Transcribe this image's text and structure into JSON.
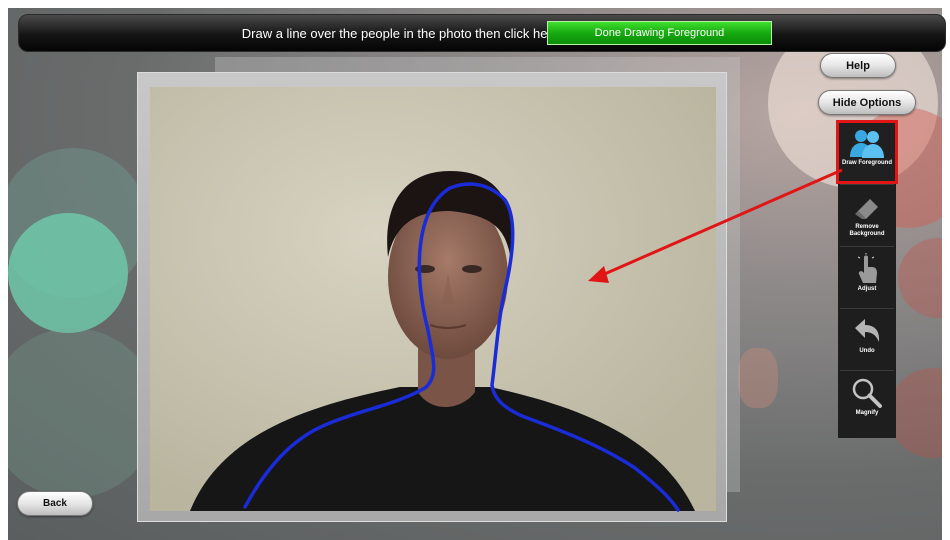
{
  "topbar": {
    "instruction": "Draw a line over the people in the photo then click here",
    "done_button": "Done Drawing Foreground"
  },
  "side_buttons": {
    "help": "Help",
    "hide_options": "Hide Options"
  },
  "tools": [
    {
      "label": "Draw Foreground",
      "icon": "people-icon",
      "selected": true
    },
    {
      "label": "Remove Background",
      "icon": "eraser-icon",
      "selected": false
    },
    {
      "label": "Adjust",
      "icon": "tap-hand-icon",
      "selected": false
    },
    {
      "label": "Undo",
      "icon": "undo-arrow-icon",
      "selected": false
    },
    {
      "label": "Magnify",
      "icon": "magnifier-icon",
      "selected": false
    }
  ],
  "footer": {
    "back": "Back"
  },
  "colors": {
    "done_button": "#17a910",
    "selection_outline": "#e01515",
    "annotation_arrow": "#e01515",
    "stroke": "#1a2bd8"
  }
}
